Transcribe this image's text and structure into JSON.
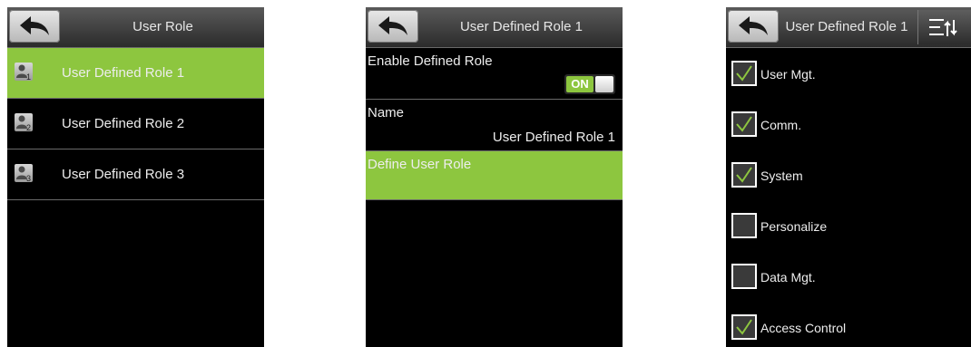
{
  "screen1": {
    "title": "User Role",
    "roles": [
      {
        "label": "User Defined Role 1",
        "number": "1",
        "selected": true
      },
      {
        "label": "User Defined Role 2",
        "number": "2",
        "selected": false
      },
      {
        "label": "User Defined Role 3",
        "number": "3",
        "selected": false
      }
    ]
  },
  "screen2": {
    "title": "User Defined Role 1",
    "enable": {
      "label": "Enable Defined Role",
      "state": "ON"
    },
    "name": {
      "label": "Name",
      "value": "User Defined Role 1"
    },
    "define": {
      "label": "Define User Role"
    }
  },
  "screen3": {
    "title": "User Defined Role 1",
    "permissions": [
      {
        "label": "User Mgt.",
        "checked": true
      },
      {
        "label": "Comm.",
        "checked": true
      },
      {
        "label": "System",
        "checked": true
      },
      {
        "label": "Personalize",
        "checked": false
      },
      {
        "label": "Data Mgt.",
        "checked": false
      },
      {
        "label": "Access Control",
        "checked": true
      }
    ]
  },
  "colors": {
    "accent": "#8dc63f",
    "background": "#000000",
    "text": "#ededed"
  },
  "icons": {
    "back": "back-arrow-icon",
    "role": "user-role-icon",
    "sort": "sort-icon",
    "check": "checkmark-icon"
  }
}
